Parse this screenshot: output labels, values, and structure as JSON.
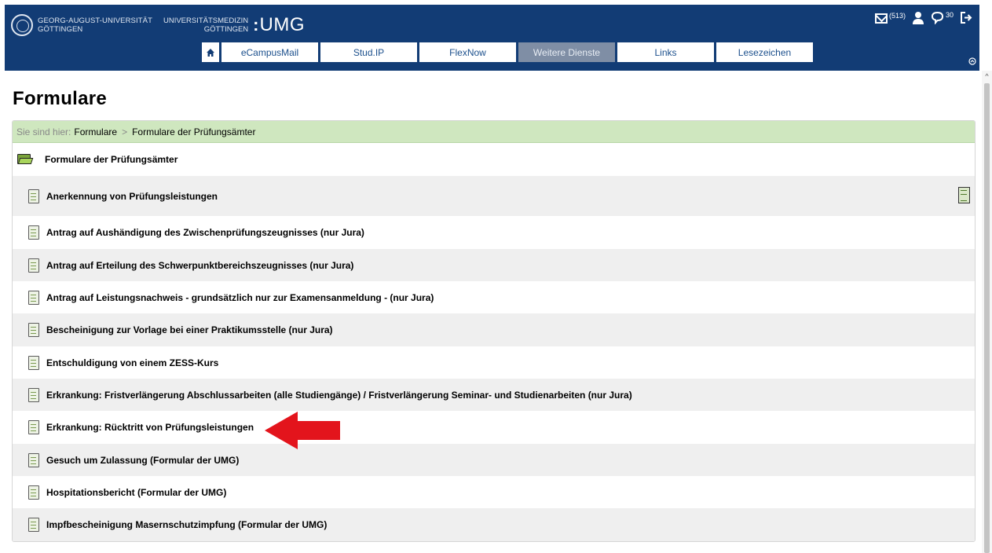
{
  "header": {
    "university_line1": "GEORG-AUGUST-UNIVERSITÄT",
    "university_line2": "GÖTTINGEN",
    "umg_line1": "UNIVERSITÄTSMEDIZIN",
    "umg_line2": "GÖTTINGEN",
    "umg_logo": "UMG",
    "mail_count": "(513)",
    "message_count": "30",
    "icons": [
      "mail-icon",
      "user-icon",
      "chat-icon",
      "logout-icon",
      "home-icon",
      "collapse-icon"
    ]
  },
  "nav": {
    "items": [
      {
        "label": "eCampusMail",
        "active": false
      },
      {
        "label": "Stud.IP",
        "active": false
      },
      {
        "label": "FlexNow",
        "active": false
      },
      {
        "label": "Weitere Dienste",
        "active": true
      },
      {
        "label": "Links",
        "active": false
      },
      {
        "label": "Lesezeichen",
        "active": false
      }
    ]
  },
  "page": {
    "title": "Formulare"
  },
  "breadcrumb": {
    "prefix": "Sie sind hier:",
    "items": [
      "Formulare",
      "Formulare der Prüfungsämter"
    ],
    "separator": ">"
  },
  "folder": {
    "label": "Formulare der Prüfungsämter"
  },
  "documents": [
    {
      "label": "Anerkennung von Prüfungsleistungen"
    },
    {
      "label": "Antrag auf Aushändigung des Zwischenprüfungszeugnisses (nur Jura)"
    },
    {
      "label": "Antrag auf Erteilung des Schwerpunktbereichszeugnisses (nur Jura)"
    },
    {
      "label": "Antrag auf Leistungsnachweis - grundsätzlich nur zur Examensanmeldung - (nur Jura)"
    },
    {
      "label": "Bescheinigung zur Vorlage bei einer Praktikumsstelle (nur Jura)"
    },
    {
      "label": "Entschuldigung von einem ZESS-Kurs"
    },
    {
      "label": "Erkrankung: Fristverlängerung Abschlussarbeiten (alle Studiengänge) / Fristverlängerung Seminar- und Studienarbeiten (nur Jura)"
    },
    {
      "label": "Erkrankung: Rücktritt von Prüfungsleistungen"
    },
    {
      "label": "Gesuch um Zulassung (Formular der UMG)"
    },
    {
      "label": "Hospitationsbericht (Formular der UMG)"
    },
    {
      "label": "Impfbescheinigung Masernschutzimpfung (Formular der UMG)"
    }
  ],
  "colors": {
    "header_bg": "#123c75",
    "nav_active_bg": "#7f8ea5",
    "breadcrumb_bg": "#cfe7bf",
    "row_alt_bg": "#efefef",
    "arrow": "#e3141c"
  }
}
